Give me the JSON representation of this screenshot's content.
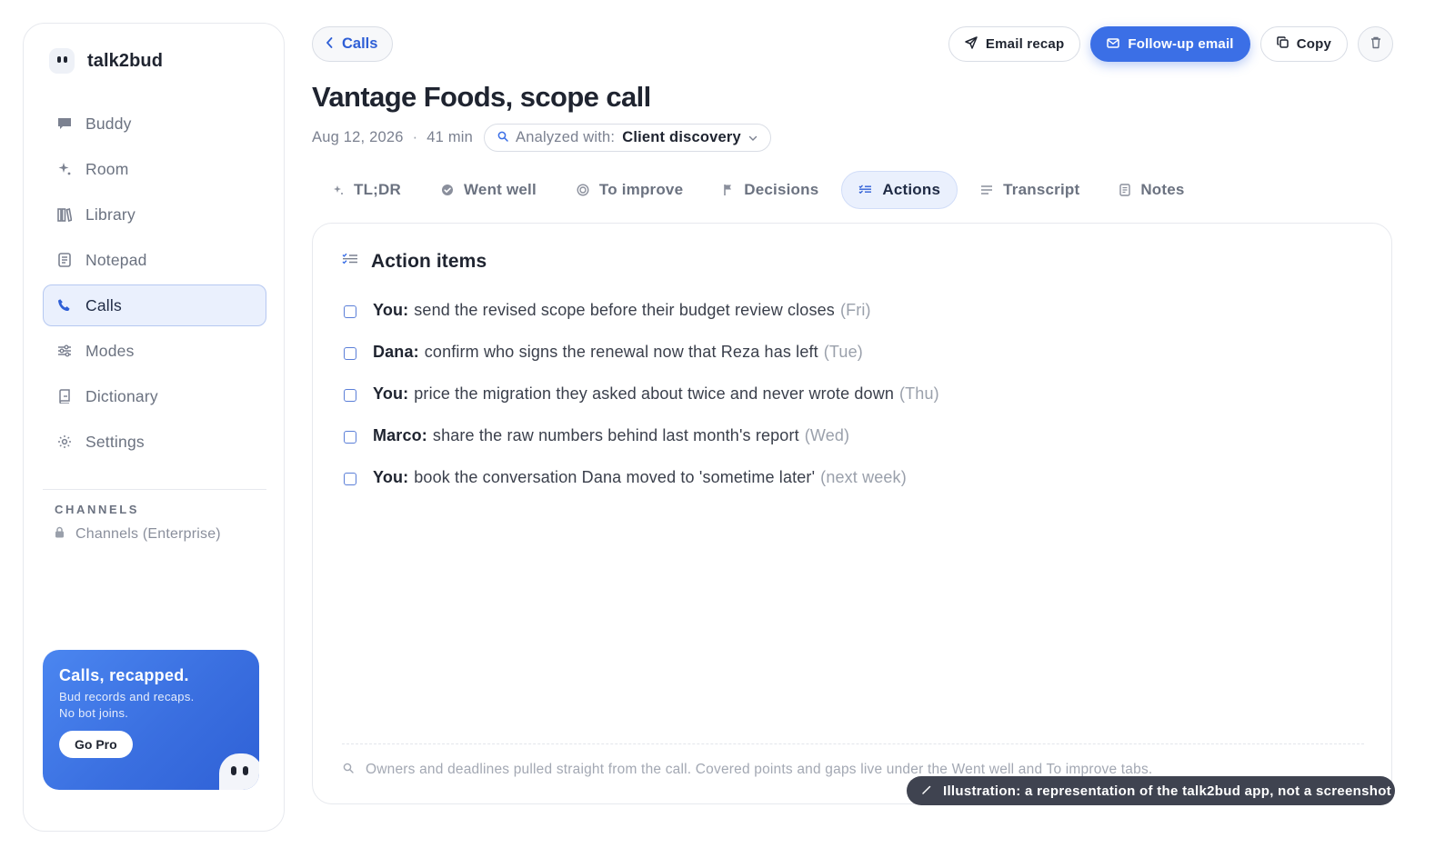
{
  "app": {
    "name": "talk2bud"
  },
  "sidebar": {
    "items": [
      {
        "label": "Buddy",
        "icon": "chat-icon"
      },
      {
        "label": "Room",
        "icon": "sparkle-icon"
      },
      {
        "label": "Library",
        "icon": "books-icon"
      },
      {
        "label": "Notepad",
        "icon": "notepad-icon"
      },
      {
        "label": "Calls",
        "icon": "phone-icon",
        "active": true
      },
      {
        "label": "Modes",
        "icon": "sliders-icon"
      },
      {
        "label": "Dictionary",
        "icon": "dictionary-icon"
      },
      {
        "label": "Settings",
        "icon": "gear-icon"
      }
    ],
    "channels_heading": "CHANNELS",
    "channels_item": "Channels (Enterprise)",
    "promo": {
      "title": "Calls, recapped.",
      "desc_line1": "Bud records and recaps.",
      "desc_line2": "No bot joins.",
      "button": "Go Pro"
    }
  },
  "header": {
    "back_label": "Calls",
    "title": "Vantage Foods, scope call",
    "date": "Aug 12, 2026",
    "separator": "·",
    "duration": "41 min",
    "analyzed_label": "Analyzed with:",
    "analyzed_value": "Client discovery",
    "buttons": {
      "email_recap": "Email recap",
      "follow_up": "Follow-up email",
      "copy": "Copy"
    }
  },
  "tabs": [
    {
      "label": "TL;DR",
      "icon": "sparkle-icon"
    },
    {
      "label": "Went well",
      "icon": "check-badge-icon"
    },
    {
      "label": "To improve",
      "icon": "target-icon"
    },
    {
      "label": "Decisions",
      "icon": "flag-icon"
    },
    {
      "label": "Actions",
      "icon": "checklist-icon",
      "active": true
    },
    {
      "label": "Transcript",
      "icon": "lines-icon"
    },
    {
      "label": "Notes",
      "icon": "note-icon"
    }
  ],
  "panel": {
    "title": "Action items",
    "items": [
      {
        "owner": "You:",
        "text": "send the revised scope before their budget review closes",
        "due": "(Fri)"
      },
      {
        "owner": "Dana:",
        "text": "confirm who signs the renewal now that Reza has left",
        "due": "(Tue)"
      },
      {
        "owner": "You:",
        "text": "price the migration they asked about twice and never wrote down",
        "due": "(Thu)"
      },
      {
        "owner": "Marco:",
        "text": "share the raw numbers behind last month's report",
        "due": "(Wed)"
      },
      {
        "owner": "You:",
        "text": "book the conversation Dana moved to 'sometime later'",
        "due": "(next week)"
      }
    ],
    "footnote": "Owners and deadlines pulled straight from the call. Covered points and gaps live under the Went well and To improve tabs."
  },
  "toast": {
    "text": "Illustration: a representation of the talk2bud app, not a screenshot"
  },
  "colors": {
    "accent": "#3b6fe6",
    "active_bg": "#eaf0fd",
    "text": "#1f2430",
    "muted": "#6b7280"
  }
}
